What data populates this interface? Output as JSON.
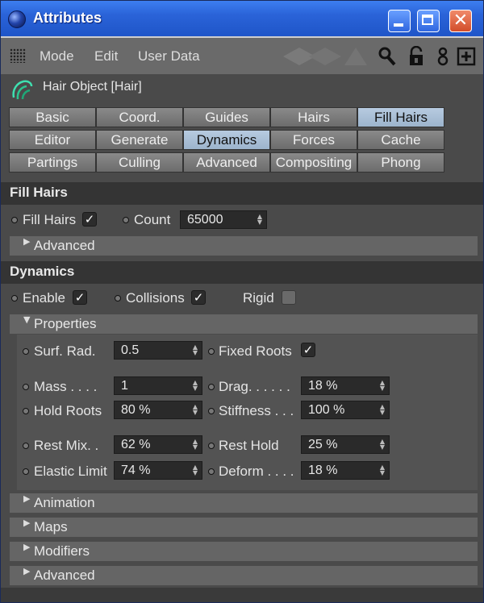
{
  "window": {
    "title": "Attributes"
  },
  "menubar": {
    "items": [
      "Mode",
      "Edit",
      "User Data"
    ]
  },
  "object": {
    "title": "Hair Object [Hair]"
  },
  "tabs": {
    "row1": [
      "Basic",
      "Coord.",
      "Guides",
      "Hairs",
      "Fill Hairs"
    ],
    "row2": [
      "Editor",
      "Generate",
      "Dynamics",
      "Forces",
      "Cache"
    ],
    "row3": [
      "Partings",
      "Culling",
      "Advanced",
      "Compositing",
      "Phong"
    ],
    "active": [
      "Fill Hairs",
      "Dynamics"
    ]
  },
  "fill_hairs": {
    "header": "Fill Hairs",
    "fill_hairs_label": "Fill Hairs",
    "fill_hairs_checked": true,
    "count_label": "Count",
    "count_value": "65000",
    "advanced": "Advanced"
  },
  "dynamics": {
    "header": "Dynamics",
    "enable_label": "Enable",
    "enable_checked": true,
    "collisions_label": "Collisions",
    "collisions_checked": true,
    "rigid_label": "Rigid",
    "rigid_checked": false,
    "properties": "Properties",
    "surf_rad_label": "Surf. Rad.",
    "surf_rad_value": "0.5",
    "fixed_roots_label": "Fixed Roots",
    "fixed_roots_checked": true,
    "mass_label": "Mass . . . .",
    "mass_value": "1",
    "drag_label": "Drag. . . . . .",
    "drag_value": "18 %",
    "hold_roots_label": "Hold Roots",
    "hold_roots_value": "80 %",
    "stiffness_label": "Stiffness . . .",
    "stiffness_value": "100 %",
    "rest_mix_label": "Rest Mix. .",
    "rest_mix_value": "62 %",
    "rest_hold_label": "Rest Hold",
    "rest_hold_value": "25 %",
    "elastic_limit_label": "Elastic Limit",
    "elastic_limit_value": "74 %",
    "deform_label": "Deform . . . .",
    "deform_value": "18 %"
  },
  "collapsed_groups": [
    "Animation",
    "Maps",
    "Modifiers",
    "Advanced"
  ],
  "colors": {
    "titlebar": "#2a63d8",
    "panel": "#4a4a4a",
    "tab_active": "#9cb4cc",
    "close_button": "#d24d2a"
  }
}
